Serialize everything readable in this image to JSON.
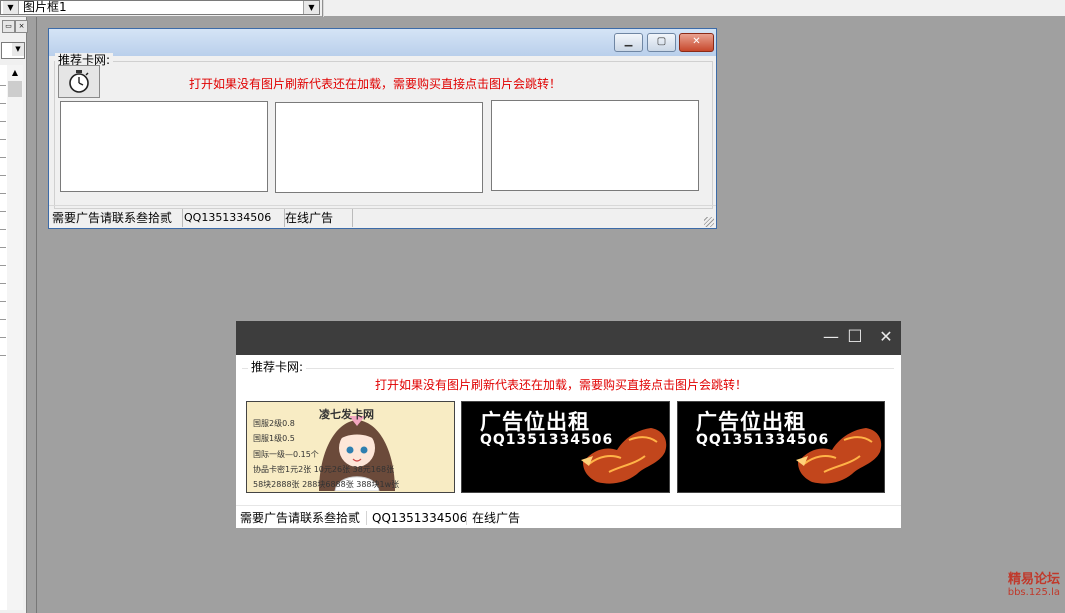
{
  "ide": {
    "object_combo_value": "图片框1"
  },
  "designer": {
    "group_label": "推荐卡网:",
    "notice": "打开如果没有图片刷新代表还在加载，需要购买直接点击图片会跳转！",
    "status": [
      "需要广告请联系叁拾贰",
      "QQ1351334506",
      "在线广告"
    ],
    "caption_buttons": [
      "minimize",
      "maximize",
      "close"
    ]
  },
  "runtime": {
    "group_label": "推荐卡网:",
    "notice": "打开如果没有图片刷新代表还在加载，需要购买直接点击图片会跳转！",
    "banners": [
      {
        "title": "凌七发卡网",
        "lines": [
          "国服2级0.8",
          "国服1级0.5",
          "国际一级—0.15个",
          "协品卡密1元2张 10元26张 38元168张",
          "58块2888张 288块6888张 388块1w张"
        ]
      },
      {
        "title": "广告位出租",
        "qq": "QQ1351334506"
      },
      {
        "title": "广告位出租",
        "qq": "QQ1351334506"
      }
    ],
    "status": [
      "需要广告请联系叁拾贰",
      "QQ1351334506",
      "在线广告"
    ],
    "caption_icons": [
      "minimize-icon",
      "maximize-icon",
      "close-icon"
    ]
  },
  "watermark": {
    "line1": "精易论坛",
    "line2": "bbs.125.la"
  },
  "colors": {
    "notice": "#e00000",
    "canvas": "#a0a0a0",
    "runtime_titlebar": "#3d3d3d"
  }
}
